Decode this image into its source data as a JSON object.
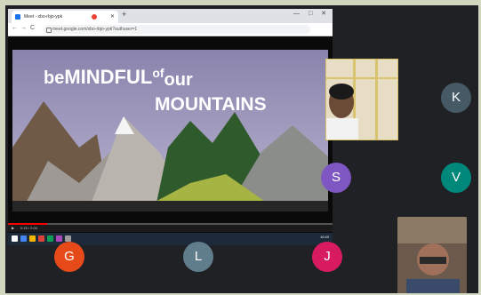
{
  "browser": {
    "tab_title": "Meet - xbo-rbjo-ypk",
    "url": "meet.google.com/xbo-rbjo-ypk?authuser=1",
    "nav": {
      "back": "←",
      "forward": "→",
      "reload": "C"
    },
    "window_controls": "— □ ✕"
  },
  "video": {
    "title_line1_a": "be",
    "title_line1_b": "MINDFUL",
    "title_line1_c": "of",
    "title_line1_d": "our",
    "title_line2": "MOUNTAINS",
    "progress": 0.12,
    "time_label": "0:15 / 2:04",
    "play_label": "▶"
  },
  "taskbar": {
    "clock": "10:43"
  },
  "participants": [
    {
      "initial": "K",
      "color": "#455a64"
    },
    {
      "initial": "S",
      "color": "#7e57c2"
    },
    {
      "initial": "V",
      "color": "#00897b"
    },
    {
      "initial": "G",
      "color": "#e64a19"
    },
    {
      "initial": "L",
      "color": "#607d8b"
    },
    {
      "initial": "J",
      "color": "#d81b60"
    }
  ]
}
